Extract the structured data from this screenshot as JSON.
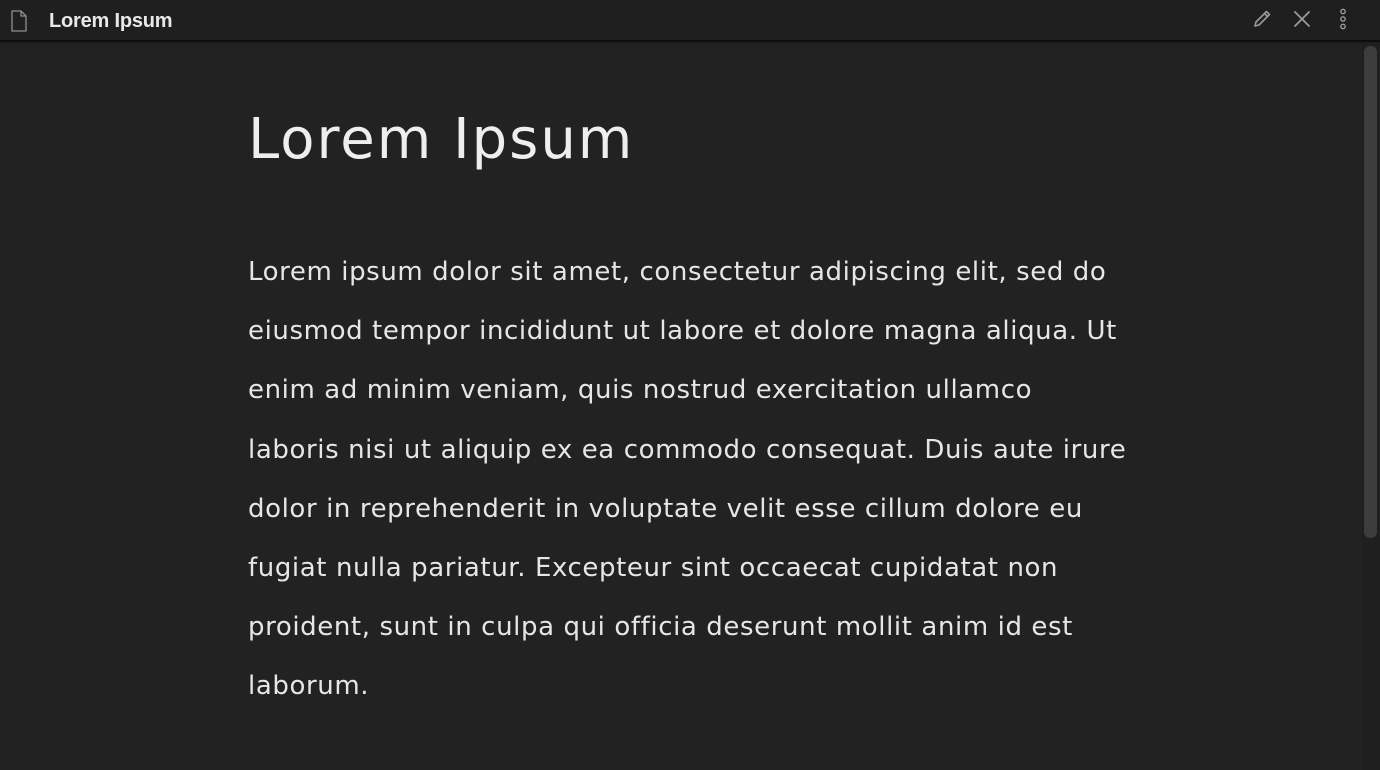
{
  "window": {
    "title": "Lorem Ipsum",
    "icons": {
      "document": "document-icon",
      "edit": "pencil-icon",
      "close": "close-icon",
      "more": "more-vertical-icon"
    }
  },
  "document": {
    "heading": "Lorem Ipsum",
    "body": "Lorem ipsum dolor sit amet, consectetur adipiscing elit, sed do eiusmod tempor incididunt ut labore et dolore magna aliqua. Ut enim ad minim veniam, quis nostrud exercitation ullamco laboris nisi ut aliquip ex ea commodo consequat. Duis aute irure dolor in reprehenderit in voluptate velit esse cillum dolore eu fugiat nulla pariatur. Excepteur sint occaecat cupidatat non proident, sunt in culpa qui officia deserunt mollit anim id est laborum."
  },
  "colors": {
    "background": "#222222",
    "titlebar": "#1f1f1f",
    "text": "#e6e6e6",
    "icon": "#9a9a9a",
    "scrollbar_thumb": "#3d3d3d"
  }
}
